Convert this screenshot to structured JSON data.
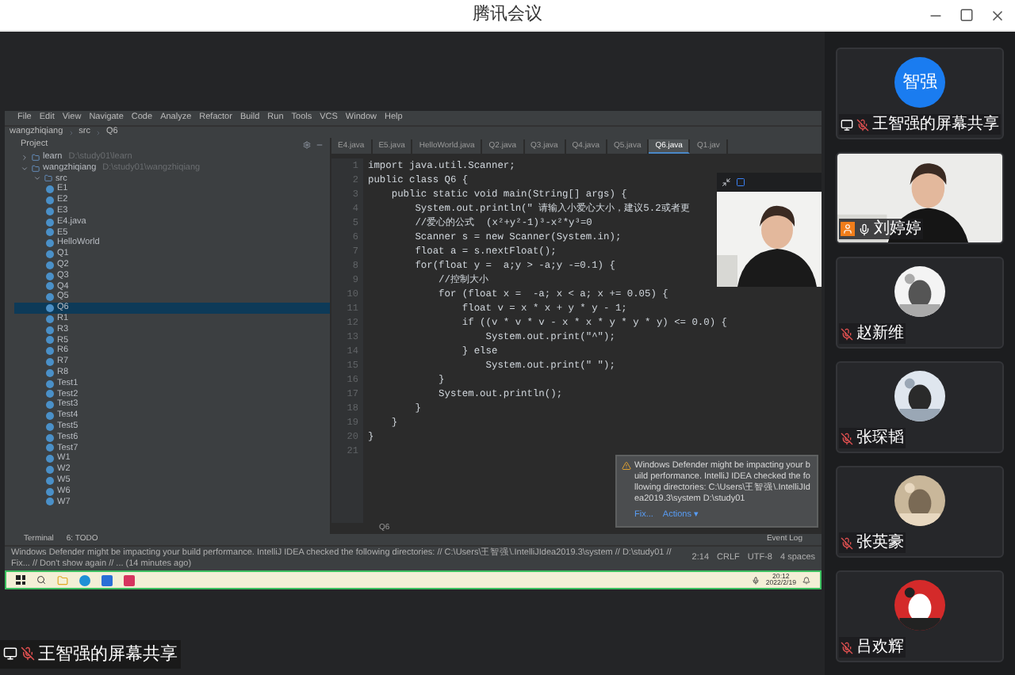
{
  "window": {
    "title": "腾讯会议"
  },
  "shared_screen": {
    "label": "王智强的屏幕共享",
    "ide": {
      "menu": [
        "File",
        "Edit",
        "View",
        "Navigate",
        "Code",
        "Analyze",
        "Refactor",
        "Build",
        "Run",
        "Tools",
        "VCS",
        "Window",
        "Help"
      ],
      "breadcrumb": [
        "wangzhiqiang",
        "src",
        "Q6"
      ],
      "project_header": "Project",
      "tree": [
        {
          "name": "learn",
          "path": "D:\\study01\\learn",
          "expanded": false,
          "selected": false
        },
        {
          "name": "wangzhiqiang",
          "path": "D:\\study01\\wangzhiqiang",
          "expanded": true,
          "selected": false,
          "children": [
            {
              "name": "src",
              "expanded": true,
              "selected": false,
              "children": [
                {
                  "name": "E1",
                  "selected": false
                },
                {
                  "name": "E2",
                  "selected": false
                },
                {
                  "name": "E3",
                  "selected": false
                },
                {
                  "name": "E4.java",
                  "selected": false
                },
                {
                  "name": "E5",
                  "selected": false
                },
                {
                  "name": "HelloWorld",
                  "selected": false
                },
                {
                  "name": "Q1",
                  "selected": false
                },
                {
                  "name": "Q2",
                  "selected": false
                },
                {
                  "name": "Q3",
                  "selected": false
                },
                {
                  "name": "Q4",
                  "selected": false
                },
                {
                  "name": "Q5",
                  "selected": false
                },
                {
                  "name": "Q6",
                  "selected": true
                },
                {
                  "name": "R1",
                  "selected": false
                },
                {
                  "name": "R3",
                  "selected": false
                },
                {
                  "name": "R5",
                  "selected": false
                },
                {
                  "name": "R6",
                  "selected": false
                },
                {
                  "name": "R7",
                  "selected": false
                },
                {
                  "name": "R8",
                  "selected": false
                },
                {
                  "name": "Test1",
                  "selected": false
                },
                {
                  "name": "Test2",
                  "selected": false
                },
                {
                  "name": "Test3",
                  "selected": false
                },
                {
                  "name": "Test4",
                  "selected": false
                },
                {
                  "name": "Test5",
                  "selected": false
                },
                {
                  "name": "Test6",
                  "selected": false
                },
                {
                  "name": "Test7",
                  "selected": false
                },
                {
                  "name": "W1",
                  "selected": false
                },
                {
                  "name": "W2",
                  "selected": false
                },
                {
                  "name": "W5",
                  "selected": false
                },
                {
                  "name": "W6",
                  "selected": false
                },
                {
                  "name": "W7",
                  "selected": false
                }
              ]
            }
          ]
        }
      ],
      "tabs": [
        {
          "label": "E4.java",
          "selected": false
        },
        {
          "label": "E5.java",
          "selected": false
        },
        {
          "label": "HelloWorld.java",
          "selected": false
        },
        {
          "label": "Q2.java",
          "selected": false
        },
        {
          "label": "Q3.java",
          "selected": false
        },
        {
          "label": "Q4.java",
          "selected": false
        },
        {
          "label": "Q5.java",
          "selected": false
        },
        {
          "label": "Q6.java",
          "selected": true
        },
        {
          "label": "Q1.jav",
          "selected": false
        }
      ],
      "code": [
        {
          "n": "1",
          "text": "import java.util.Scanner;"
        },
        {
          "n": "2",
          "text": "public class Q6 {"
        },
        {
          "n": "3",
          "text": "    public static void main(String[] args) {"
        },
        {
          "n": "4",
          "text": "        System.out.println(\" 请输入小爱心大小，建议5.2或者更"
        },
        {
          "n": "5",
          "text": "        //爱心的公式  (x²+y²-1)³-x²*y³=0"
        },
        {
          "n": "6",
          "text": "        Scanner s = new Scanner(System.in);"
        },
        {
          "n": "7",
          "text": "        float a = s.nextFloat();"
        },
        {
          "n": "8",
          "text": "        for(float y =  a;y > -a;y -=0.1) {"
        },
        {
          "n": "9",
          "text": "            //控制大小"
        },
        {
          "n": "10",
          "text": "            for (float x =  -a; x < a; x += 0.05) {"
        },
        {
          "n": "11",
          "text": "                float v = x * x + y * y - 1;"
        },
        {
          "n": "12",
          "text": "                if ((v * v * v - x * x * y * y * y) <= 0.0) {"
        },
        {
          "n": "13",
          "text": "                    System.out.print(\"^\");"
        },
        {
          "n": "14",
          "text": "                } else"
        },
        {
          "n": "15",
          "text": "                    System.out.print(\" \");"
        },
        {
          "n": "16",
          "text": "            }"
        },
        {
          "n": "17",
          "text": "            System.out.println();"
        },
        {
          "n": "18",
          "text": "        }"
        },
        {
          "n": "19",
          "text": "    }"
        },
        {
          "n": "20",
          "text": "}"
        },
        {
          "n": "21"
        }
      ],
      "editor_breadcrumb": "Q6",
      "notification": {
        "text": "Windows Defender might be impacting your build performance. IntelliJ IDEA checked the following directories: C:\\Users\\王智强\\.IntelliJIdea2019.3\\system D:\\study01",
        "actions": [
          "Fix...",
          "Actions ▾"
        ]
      },
      "tool_windows": [
        "Terminal",
        "6: TODO"
      ],
      "event_log": "Event Log",
      "status": {
        "message": "Windows Defender might be impacting your build performance. IntelliJ IDEA checked the following directories: // C:\\Users\\王智强\\.IntelliJIdea2019.3\\system // D:\\study01 // Fix... // Don't show again // ... (14 minutes ago)",
        "items": [
          "2:14",
          "CRLF",
          "UTF-8",
          "4 spaces"
        ]
      },
      "taskbar": {
        "time": "20:12",
        "date": "2022/2/19"
      }
    }
  },
  "participants": [
    {
      "name": "王智强的屏幕共享",
      "kind": "text",
      "avatar_text": "智强",
      "muted": true,
      "sharing": true,
      "host": false
    },
    {
      "name": "刘婷婷",
      "kind": "video",
      "muted": false,
      "sharing": false,
      "host": true
    },
    {
      "name": "赵新维",
      "kind": "picture",
      "muted": true,
      "sharing": false,
      "host": false
    },
    {
      "name": "张琛韬",
      "kind": "picture",
      "muted": true,
      "sharing": false,
      "host": false
    },
    {
      "name": "张英豪",
      "kind": "picture",
      "muted": true,
      "sharing": false,
      "host": false
    },
    {
      "name": "吕欢辉",
      "kind": "picture",
      "muted": true,
      "sharing": false,
      "host": false
    }
  ]
}
